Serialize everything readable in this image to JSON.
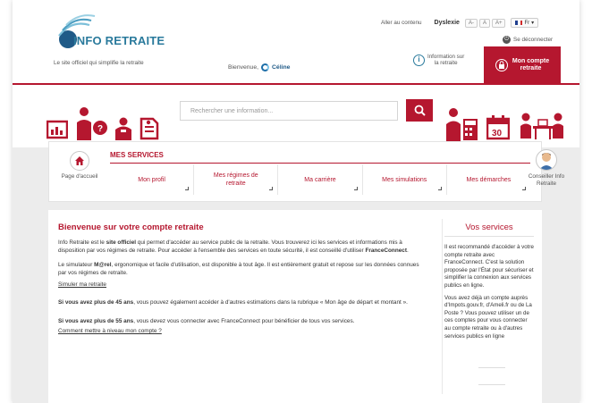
{
  "header": {
    "logo_text": "INFO RETRAITE",
    "tagline": "Le site officiel qui simplifie la retraite",
    "welcome_label": "Bienvenue,",
    "user_name": "Céline",
    "skip_link": "Aller au contenu",
    "dyslexie_label": "Dyslexie",
    "font_small": "A-",
    "font_normal": "A",
    "font_large": "A+",
    "language": "Fr",
    "logout_label": "Se déconnecter",
    "info_line1": "Information sur",
    "info_line2": "la retraite",
    "account_line1": "Mon compte",
    "account_line2": "retraite"
  },
  "search": {
    "placeholder": "Rechercher une information..."
  },
  "services": {
    "title": "MES SERVICES",
    "home_label": "Page d'accueil",
    "advisor_line1": "Conseiller Info",
    "advisor_line2": "Retraite",
    "tabs": [
      {
        "label": "Mon profil"
      },
      {
        "label": "Mes régimes de retraite"
      },
      {
        "label": "Ma carrière"
      },
      {
        "label": "Mes simulations"
      },
      {
        "label": "Mes démarches"
      }
    ]
  },
  "main": {
    "title": "Bienvenue sur votre compte retraite",
    "p1_a": "Info Retraite est le ",
    "p1_b": "site officiel",
    "p1_c": " qui permet d'accéder au service public de la retraite. Vous trouverez ici les services et informations mis à disposition par vos régimes de retraite. Pour accéder à l'ensemble des services en toute sécurité, il est conseillé d'utiliser ",
    "p1_d": "FranceConnect",
    "p1_e": ".",
    "p2_a": "Le simulateur ",
    "p2_b": "M@rel",
    "p2_c": ", ergonomique et facile d'utilisation, est disponible à tout âge. Il est entièrement gratuit et repose sur les données connues par vos régimes de retraite.",
    "link_simulate": "Simuler ma retraite",
    "p3_a": "Si vous avez plus de 45 ans",
    "p3_b": ", vous pouvez également accéder à d'autres estimations dans la rubrique « Mon âge de départ et montant ».",
    "p4_a": "Si vous avez plus de 55 ans",
    "p4_b": ", vous devez vous connecter avec FranceConnect pour bénéficier de tous vos services.",
    "link_level": "Comment mettre à niveau mon compte ?"
  },
  "side": {
    "title": "Vos services",
    "p1": "Il est recommandé d'accéder à votre compte retraite avec FranceConnect. C'est la solution proposée par l'État pour sécuriser et simplifier la connexion aux services publics en ligne.",
    "p2": "Vous avez déjà un compte auprès d'Impots.gouv.fr, d'Ameli.fr ou de La Poste ? Vous pouvez utiliser un de ces comptes pour vous connecter au compte retraite ou à d'autres services publics en ligne"
  },
  "colors": {
    "brand_red": "#b5172f",
    "brand_blue": "#2a7a9c",
    "background_gray": "#ececec"
  },
  "icons": [
    "logo-icon",
    "user-ring-icon",
    "power-icon",
    "info-icon",
    "lock-icon",
    "search-icon",
    "home-icon",
    "advisor-avatar",
    "pictogram-chart-icon",
    "pictogram-person-question-icon",
    "pictogram-people-icon",
    "pictogram-document-icon",
    "pictogram-calculator-icon",
    "pictogram-calendar-icon",
    "pictogram-office-icon"
  ]
}
